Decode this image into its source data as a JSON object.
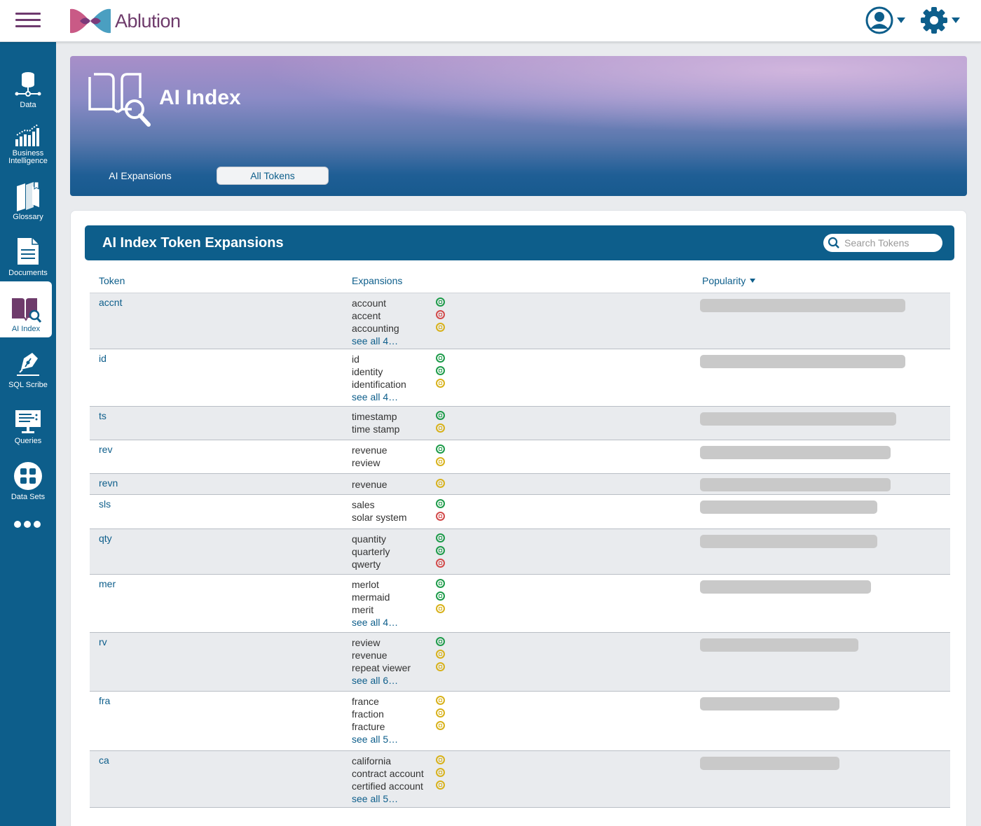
{
  "app": {
    "name": "Ablution"
  },
  "sidebar": {
    "items": [
      {
        "label": "Data",
        "icon": "database-icon"
      },
      {
        "label": "Business Intelligence",
        "icon": "bar-chart-icon"
      },
      {
        "label": "Glossary",
        "icon": "books-icon"
      },
      {
        "label": "Documents",
        "icon": "document-icon"
      },
      {
        "label": "AI Index",
        "icon": "book-search-icon",
        "active": true
      },
      {
        "label": "SQL Scribe",
        "icon": "pen-nib-icon"
      },
      {
        "label": "Queries",
        "icon": "monitor-icon"
      },
      {
        "label": "Data Sets",
        "icon": "grid-circle-icon"
      }
    ],
    "more_icon": "more-icon"
  },
  "page": {
    "title": "AI Index"
  },
  "tabs": [
    {
      "label": "AI Expansions",
      "selected": false
    },
    {
      "label": "All Tokens",
      "selected": true
    }
  ],
  "card": {
    "title": "AI Index Token Expansions",
    "search_placeholder": "Search Tokens"
  },
  "table": {
    "headers": {
      "token": "Token",
      "expansions": "Expansions",
      "popularity": "Popularity"
    },
    "rows": [
      {
        "token": "accnt",
        "popularity": 0.905,
        "see_all": "see all 4…",
        "expansions": [
          {
            "text": "account",
            "status": "green"
          },
          {
            "text": "accent",
            "status": "red"
          },
          {
            "text": "accounting",
            "status": "yellow"
          }
        ]
      },
      {
        "token": "id",
        "popularity": 0.905,
        "see_all": "see all 4…",
        "expansions": [
          {
            "text": "id",
            "status": "green"
          },
          {
            "text": "identity",
            "status": "green"
          },
          {
            "text": "identification",
            "status": "yellow"
          }
        ]
      },
      {
        "token": "ts",
        "popularity": 0.865,
        "see_all": "",
        "expansions": [
          {
            "text": "timestamp",
            "status": "green"
          },
          {
            "text": "time stamp",
            "status": "yellow"
          }
        ]
      },
      {
        "token": "rev",
        "popularity": 0.838,
        "see_all": "",
        "expansions": [
          {
            "text": "revenue",
            "status": "green"
          },
          {
            "text": "review",
            "status": "yellow"
          }
        ]
      },
      {
        "token": "revn",
        "popularity": 0.838,
        "see_all": "",
        "expansions": [
          {
            "text": "revenue",
            "status": "yellow"
          }
        ]
      },
      {
        "token": "sls",
        "popularity": 0.782,
        "see_all": "",
        "expansions": [
          {
            "text": "sales",
            "status": "green"
          },
          {
            "text": "solar system",
            "status": "red"
          }
        ]
      },
      {
        "token": "qty",
        "popularity": 0.782,
        "see_all": "",
        "expansions": [
          {
            "text": "quantity",
            "status": "green"
          },
          {
            "text": "quarterly",
            "status": "green"
          },
          {
            "text": "qwerty",
            "status": "red"
          }
        ]
      },
      {
        "token": "mer",
        "popularity": 0.754,
        "see_all": "see all 4…",
        "expansions": [
          {
            "text": "merlot",
            "status": "green"
          },
          {
            "text": "mermaid",
            "status": "green"
          },
          {
            "text": "merit",
            "status": "yellow"
          }
        ]
      },
      {
        "token": "rv",
        "popularity": 0.698,
        "see_all": "see all 6…",
        "expansions": [
          {
            "text": "review",
            "status": "green"
          },
          {
            "text": "revenue",
            "status": "yellow"
          },
          {
            "text": "repeat viewer",
            "status": "yellow"
          }
        ]
      },
      {
        "token": "fra",
        "popularity": 0.615,
        "see_all": "see all 5…",
        "expansions": [
          {
            "text": "france",
            "status": "yellow"
          },
          {
            "text": "fraction",
            "status": "yellow"
          },
          {
            "text": "fracture",
            "status": "yellow"
          }
        ]
      },
      {
        "token": "ca",
        "popularity": 0.615,
        "see_all": "see all 5…",
        "expansions": [
          {
            "text": "california",
            "status": "yellow"
          },
          {
            "text": "contract account",
            "status": "yellow"
          },
          {
            "text": "certified account",
            "status": "yellow"
          }
        ]
      }
    ]
  },
  "colors": {
    "brand_blue": "#0d5e8b",
    "brand_purple": "#6e3b6b",
    "status_green": "#1e9b4a",
    "status_red": "#d24a4a",
    "status_yellow": "#d8b21c",
    "bar_gray": "#c9c9c9"
  }
}
